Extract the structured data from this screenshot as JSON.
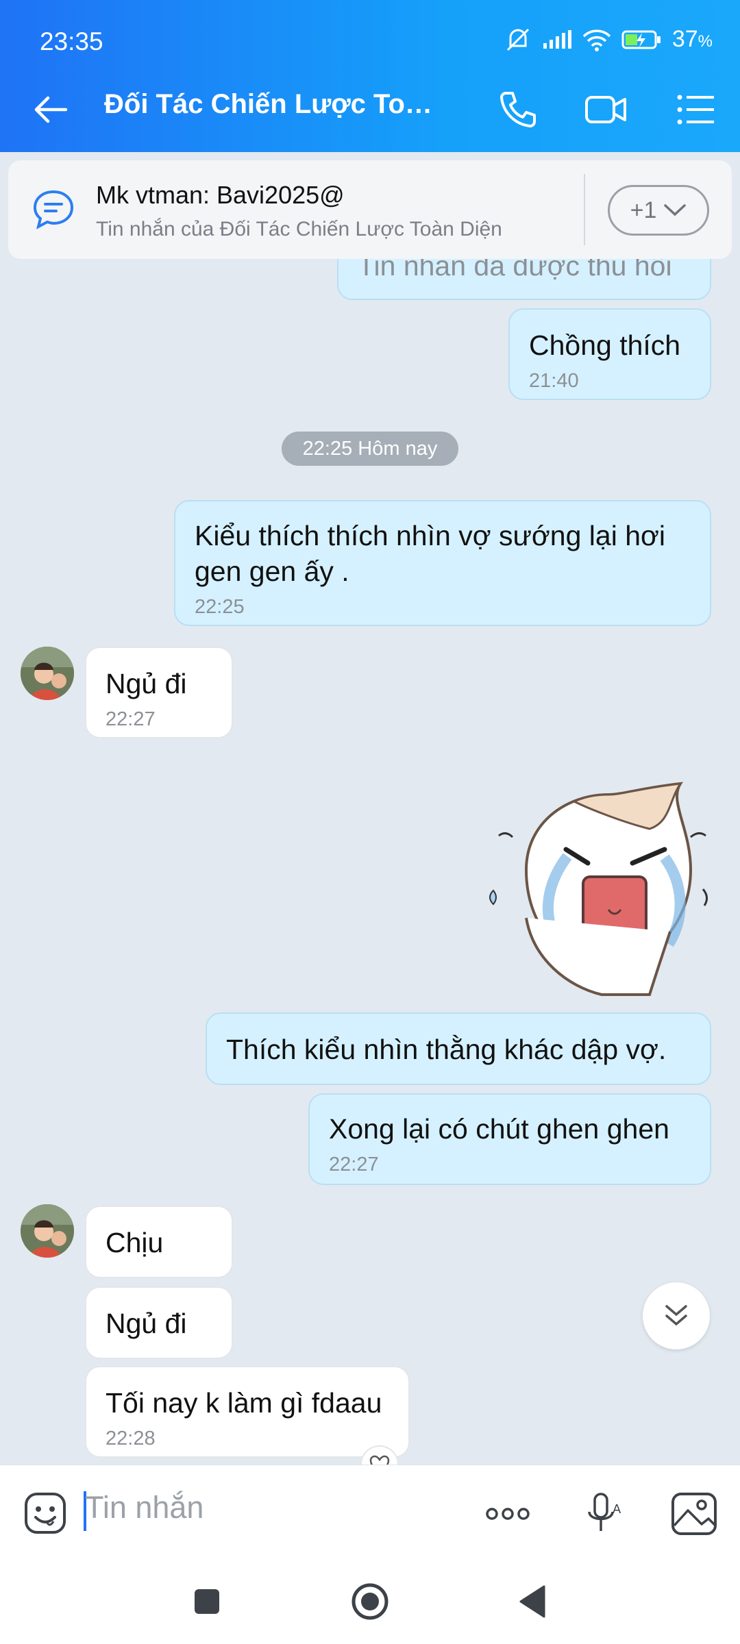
{
  "status": {
    "time": "23:35",
    "battery": "37",
    "battery_unit": "%"
  },
  "header": {
    "title": "Đối Tác Chiến Lược Toà..."
  },
  "pinned": {
    "title": "Mk vtman: Bavi2025@",
    "subtitle": "Tin nhắn của Đối Tác Chiến Lược Toàn Diện",
    "more_label": "+1"
  },
  "messages": {
    "recalled": "Tin nhắn đã được thu hồi",
    "m1": {
      "text": "Chồng thích",
      "time": "21:40"
    },
    "date_chip": "22:25 Hôm nay",
    "m2": {
      "text": "Kiểu thích thích nhìn vợ sướng lại hơi gen gen ấy .",
      "time": "22:25"
    },
    "m3": {
      "text": "Ngủ đi",
      "time": "22:27"
    },
    "m4": {
      "text": "Thích kiểu nhìn thằng khác dập vợ."
    },
    "m5": {
      "text": "Xong lại có chút ghen ghen",
      "time": "22:27"
    },
    "m6": {
      "text": "Chịu"
    },
    "m7": {
      "text": "Ngủ đi"
    },
    "m8": {
      "text": "Tối nay k làm gì fdaau",
      "time": "22:28"
    }
  },
  "input": {
    "placeholder": "Tin nhắn"
  },
  "colors": {
    "header_start": "#1f73f5",
    "header_end": "#1aa8fb",
    "my_bubble": "#d5f1ff",
    "background": "#e3e9f1"
  }
}
